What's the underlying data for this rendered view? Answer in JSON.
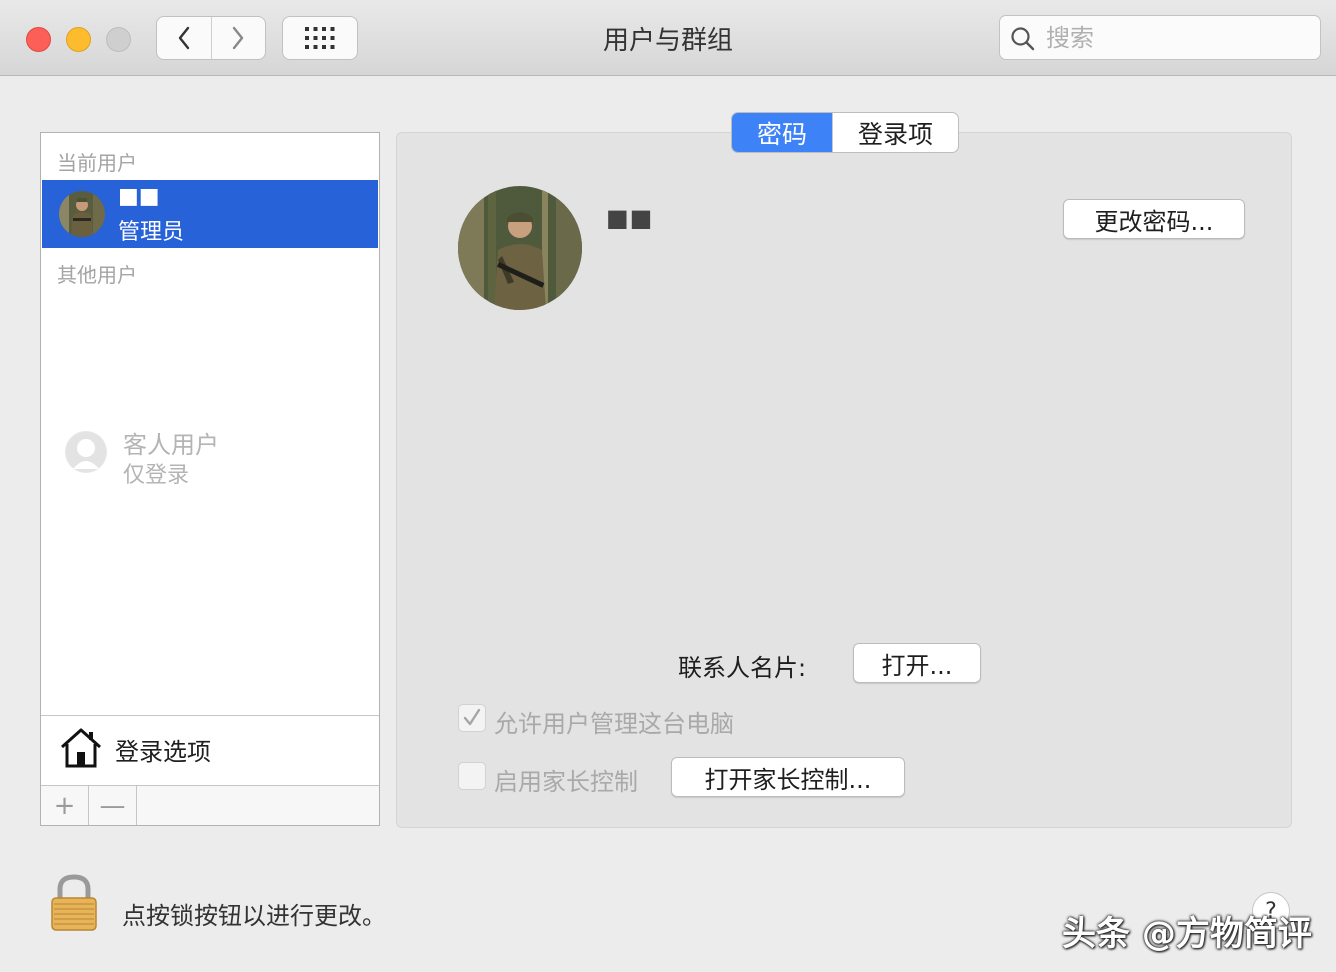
{
  "window": {
    "title": "用户与群组"
  },
  "toolbar": {
    "search_placeholder": "搜索"
  },
  "sidebar": {
    "current_header": "当前用户",
    "current_user": {
      "name": "■■",
      "role": "管理员"
    },
    "other_header": "其他用户",
    "guest": {
      "name": "客人用户",
      "sub": "仅登录"
    },
    "login_options": "登录选项",
    "add_symbol": "+",
    "remove_symbol": "—"
  },
  "tabs": [
    {
      "label": "密码",
      "active": true
    },
    {
      "label": "登录项",
      "active": false
    }
  ],
  "main": {
    "user_name": "■■",
    "change_password": "更改密码...",
    "contact_card_label": "联系人名片:",
    "open_button": "打开...",
    "allow_admin_label": "允许用户管理这台电脑",
    "allow_admin_checked": true,
    "parental_label": "启用家长控制",
    "parental_checked": false,
    "open_parental_button": "打开家长控制..."
  },
  "footer": {
    "lock_text": "点按锁按钮以进行更改。",
    "help_symbol": "?"
  },
  "watermark": "头条 @方物简评",
  "colors": {
    "selection": "#2862d8",
    "active_tab": "#3d82f7",
    "close": "#fc5f57",
    "minimize": "#fdbc2e"
  }
}
